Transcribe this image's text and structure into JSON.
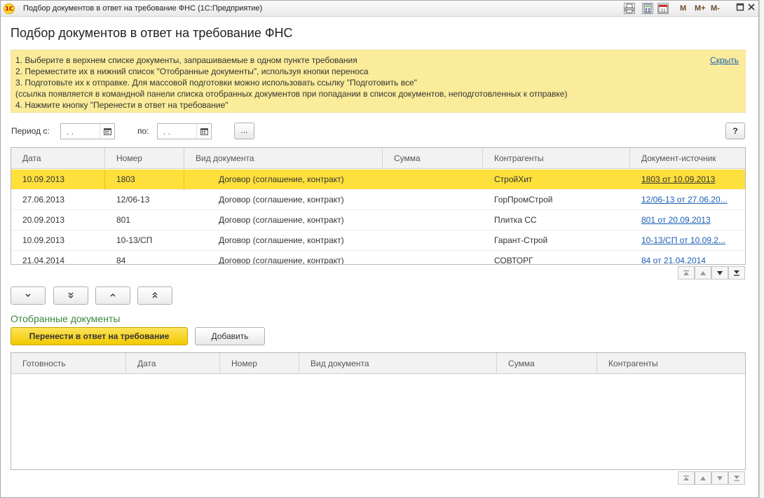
{
  "window": {
    "title": "Подбор документов в ответ на требование ФНС  (1С:Предприятие)",
    "logo": "1С",
    "toolbar_m": "M",
    "toolbar_mplus": "M+",
    "toolbar_mminus": "M-",
    "calendar_day": "31"
  },
  "form_title": "Подбор документов в ответ на требование ФНС",
  "info": {
    "lines": [
      "1. Выберите в верхнем списке документы, запрашиваемые в одном пункте требования",
      "2. Переместите их в нижний список \"Отобранные документы\", используя кнопки переноса",
      "3. Подготовьте их к отправке. Для массовой подготовки можно использовать ссылку \"Подготовить все\"",
      "(ссылка появляется в командной панели списка отобранных документов при попадании в список документов, неподготовленных к отправке)",
      "4. Нажмите кнопку \"Перенести в ответ на требование\""
    ],
    "hide_link": "Скрыть"
  },
  "filter": {
    "period_from_label": "Период с:",
    "period_to_label": "по:",
    "date_from": " .  .",
    "date_to": " .  .",
    "ellipsis_button": "...",
    "help_button": "?"
  },
  "top_grid": {
    "columns": [
      "Дата",
      "Номер",
      "Вид документа",
      "Сумма",
      "Контрагенты",
      "Документ-источник"
    ],
    "rows": [
      {
        "date": "10.09.2013",
        "number": "1803",
        "type": "Договор (соглашение, контракт)",
        "sum": "",
        "counterparty": "СтройХит",
        "source": "1803 от 10.09.2013",
        "selected": true
      },
      {
        "date": "27.06.2013",
        "number": "12/06-13",
        "type": "Договор (соглашение, контракт)",
        "sum": "",
        "counterparty": "ГорПромСтрой",
        "source": "12/06-13 от 27.06.20...",
        "selected": false
      },
      {
        "date": "20.09.2013",
        "number": "801",
        "type": "Договор (соглашение, контракт)",
        "sum": "",
        "counterparty": "Плитка СС",
        "source": "801 от 20.09.2013",
        "selected": false
      },
      {
        "date": "10.09.2013",
        "number": "10-13/СП",
        "type": "Договор (соглашение, контракт)",
        "sum": "",
        "counterparty": "Гарант-Строй",
        "source": "10-13/СП от 10.09.2...",
        "selected": false
      },
      {
        "date": "21.04.2014",
        "number": "84",
        "type": "Договор (соглашение, контракт)",
        "sum": "",
        "counterparty": "СОВТОРГ",
        "source": "84 от 21.04.2014",
        "selected": false
      }
    ]
  },
  "move_buttons": {
    "down": "⌄",
    "down_all": "⌄⌄",
    "up": "⌃",
    "up_all": "⌃⌃"
  },
  "selected_section": {
    "title": "Отобранные документы",
    "transfer_button": "Перенести в ответ на требование",
    "add_button": "Добавить"
  },
  "bottom_grid": {
    "columns": [
      "Готовность",
      "Дата",
      "Номер",
      "Вид документа",
      "Сумма",
      "Контрагенты"
    ],
    "rows": []
  },
  "colors": {
    "selected_row": "#fde03c",
    "info_bg": "#faec9a",
    "link": "#1a5fb4",
    "section_title": "#3a8a3a",
    "primary_button": "#f7d21e"
  }
}
